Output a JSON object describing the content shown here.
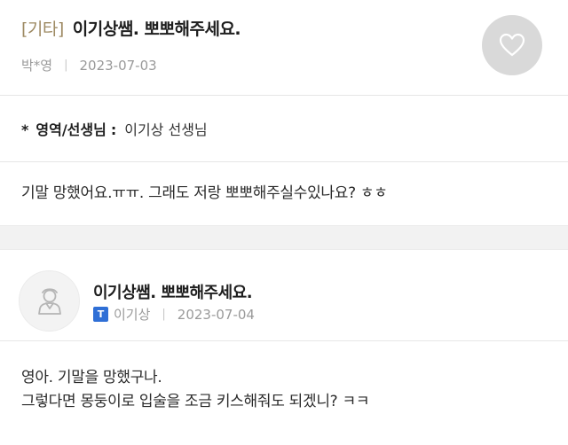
{
  "post": {
    "category": "[기타]",
    "title": "이기상쌤. 뽀뽀해주세요.",
    "author": "박*영",
    "separator": "|",
    "date": "2023-07-03"
  },
  "field": {
    "marker": "*",
    "label": "영역/선생님",
    "colon": ":",
    "value": "이기상 선생님"
  },
  "question": {
    "body": "기말 망했어요.ㅠㅠ. 그래도 저랑 뽀뽀해주실수있나요? ㅎㅎ"
  },
  "answer": {
    "title": "이기상쌤. 뽀뽀해주세요.",
    "badge": "T",
    "author": "이기상",
    "separator": "|",
    "date": "2023-07-04",
    "lines": [
      "영아. 기말을 망했구나.",
      "그렇다면 몽둥이로 입술을 조금 키스해줘도 되겠니? ㅋㅋ"
    ]
  },
  "icons": {
    "like": "heart-icon",
    "avatar": "teacher-avatar-icon"
  },
  "colors": {
    "category": "#9e8a63",
    "badge": "#2f6fd6",
    "like_bg": "#d9d9d9",
    "divider_band": "#f2f2f2"
  }
}
